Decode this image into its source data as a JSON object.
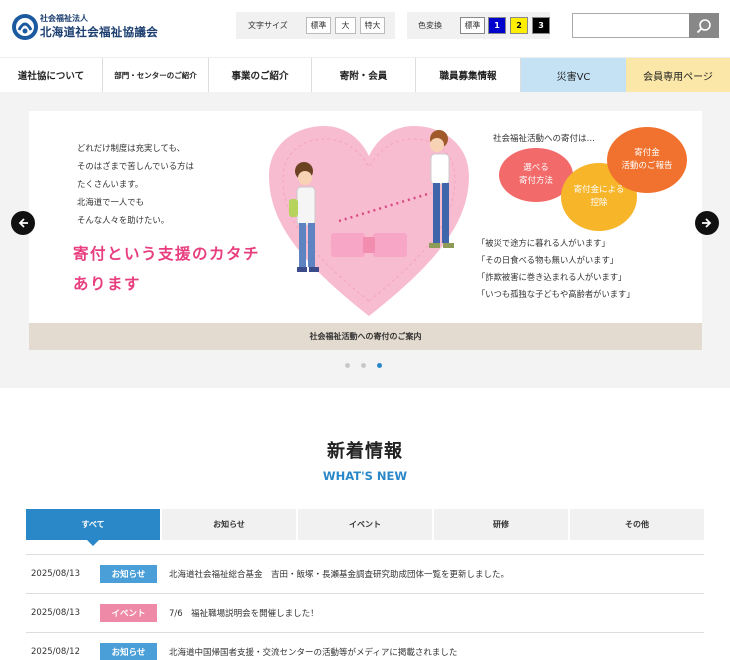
{
  "header": {
    "org_sub": "社会福祉法人",
    "org_name": "北海道社会福祉協議会",
    "font_size_label": "文字サイズ",
    "font_sizes": [
      "標準",
      "大",
      "特大"
    ],
    "color_label": "色変換",
    "color_options": [
      {
        "label": "標準",
        "bg": "#ffffff",
        "fg": "#333333"
      },
      {
        "label": "1",
        "bg": "#0000cc",
        "fg": "#ffffff"
      },
      {
        "label": "2",
        "bg": "#ffee00",
        "fg": "#000000"
      },
      {
        "label": "3",
        "bg": "#000000",
        "fg": "#ffffff"
      }
    ],
    "search_placeholder": ""
  },
  "nav": [
    "道社協について",
    "部門・センターのご紹介",
    "事業のご紹介",
    "寄附・会員",
    "職員募集情報",
    "災害VC",
    "会員専用ページ"
  ],
  "slide": {
    "text": "どれだけ制度は充実しても、\nそのはざまで苦しんでいる方は\nたくさんいます。\n北海道で一人でも\nそんな人々を助けたい。",
    "headline": "寄付という支援のカタチ\nあります",
    "donate_title": "社会福祉活動への寄付は…",
    "bubbles": [
      {
        "text": "選べる\n寄付方法",
        "color": "#f26a6a"
      },
      {
        "text": "寄付金による\n控除",
        "color": "#f7b52a"
      },
      {
        "text": "寄付金\n活動のご報告",
        "color": "#f0722e"
      }
    ],
    "quotes": "「被災で途方に暮れる人がいます」\n「その日食べる物も無い人がいます」\n「詐欺被害に巻き込まれる人がいます」\n「いつも孤独な子どもや高齢者がいます」",
    "caption": "社会福祉活動への寄付のご案内"
  },
  "carousel": {
    "slide_count": 3,
    "active_index": 2
  },
  "news": {
    "title": "新着情報",
    "subtitle": "WHAT'S NEW",
    "tabs": [
      "すべて",
      "お知らせ",
      "イベント",
      "研修",
      "その他"
    ],
    "active_tab": 0,
    "items": [
      {
        "date": "2025/08/13",
        "category": "お知らせ",
        "category_color": "#4a9fd8",
        "text": "北海道社会福祉総合基金　吉田・飯塚・長瀬基金調査研究助成団体一覧を更新しました。"
      },
      {
        "date": "2025/08/13",
        "category": "イベント",
        "category_color": "#ee8aa8",
        "text": "7/6　福祉職場説明会を開催しました！"
      },
      {
        "date": "2025/08/12",
        "category": "お知らせ",
        "category_color": "#4a9fd8",
        "text": "北海道中国帰国者支援・交流センターの活動等がメディアに掲載されました"
      }
    ]
  }
}
